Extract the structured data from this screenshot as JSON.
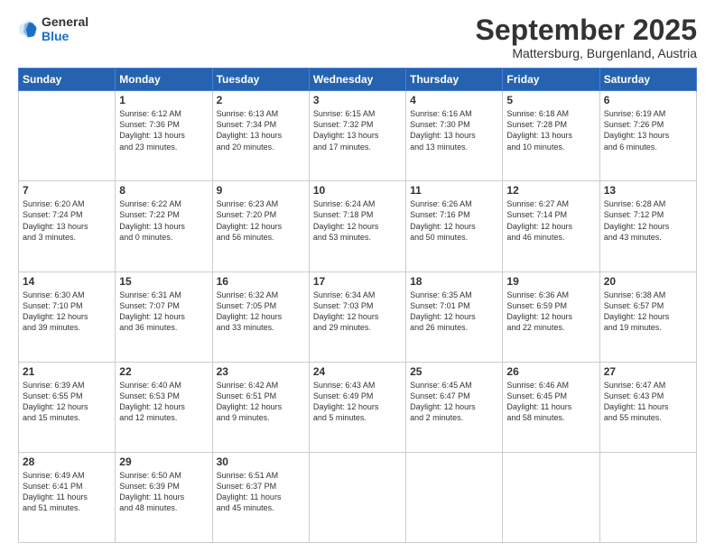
{
  "logo": {
    "general": "General",
    "blue": "Blue"
  },
  "header": {
    "month": "September 2025",
    "location": "Mattersburg, Burgenland, Austria"
  },
  "days": [
    "Sunday",
    "Monday",
    "Tuesday",
    "Wednesday",
    "Thursday",
    "Friday",
    "Saturday"
  ],
  "weeks": [
    [
      {
        "day": "",
        "info": ""
      },
      {
        "day": "1",
        "info": "Sunrise: 6:12 AM\nSunset: 7:36 PM\nDaylight: 13 hours\nand 23 minutes."
      },
      {
        "day": "2",
        "info": "Sunrise: 6:13 AM\nSunset: 7:34 PM\nDaylight: 13 hours\nand 20 minutes."
      },
      {
        "day": "3",
        "info": "Sunrise: 6:15 AM\nSunset: 7:32 PM\nDaylight: 13 hours\nand 17 minutes."
      },
      {
        "day": "4",
        "info": "Sunrise: 6:16 AM\nSunset: 7:30 PM\nDaylight: 13 hours\nand 13 minutes."
      },
      {
        "day": "5",
        "info": "Sunrise: 6:18 AM\nSunset: 7:28 PM\nDaylight: 13 hours\nand 10 minutes."
      },
      {
        "day": "6",
        "info": "Sunrise: 6:19 AM\nSunset: 7:26 PM\nDaylight: 13 hours\nand 6 minutes."
      }
    ],
    [
      {
        "day": "7",
        "info": "Sunrise: 6:20 AM\nSunset: 7:24 PM\nDaylight: 13 hours\nand 3 minutes."
      },
      {
        "day": "8",
        "info": "Sunrise: 6:22 AM\nSunset: 7:22 PM\nDaylight: 13 hours\nand 0 minutes."
      },
      {
        "day": "9",
        "info": "Sunrise: 6:23 AM\nSunset: 7:20 PM\nDaylight: 12 hours\nand 56 minutes."
      },
      {
        "day": "10",
        "info": "Sunrise: 6:24 AM\nSunset: 7:18 PM\nDaylight: 12 hours\nand 53 minutes."
      },
      {
        "day": "11",
        "info": "Sunrise: 6:26 AM\nSunset: 7:16 PM\nDaylight: 12 hours\nand 50 minutes."
      },
      {
        "day": "12",
        "info": "Sunrise: 6:27 AM\nSunset: 7:14 PM\nDaylight: 12 hours\nand 46 minutes."
      },
      {
        "day": "13",
        "info": "Sunrise: 6:28 AM\nSunset: 7:12 PM\nDaylight: 12 hours\nand 43 minutes."
      }
    ],
    [
      {
        "day": "14",
        "info": "Sunrise: 6:30 AM\nSunset: 7:10 PM\nDaylight: 12 hours\nand 39 minutes."
      },
      {
        "day": "15",
        "info": "Sunrise: 6:31 AM\nSunset: 7:07 PM\nDaylight: 12 hours\nand 36 minutes."
      },
      {
        "day": "16",
        "info": "Sunrise: 6:32 AM\nSunset: 7:05 PM\nDaylight: 12 hours\nand 33 minutes."
      },
      {
        "day": "17",
        "info": "Sunrise: 6:34 AM\nSunset: 7:03 PM\nDaylight: 12 hours\nand 29 minutes."
      },
      {
        "day": "18",
        "info": "Sunrise: 6:35 AM\nSunset: 7:01 PM\nDaylight: 12 hours\nand 26 minutes."
      },
      {
        "day": "19",
        "info": "Sunrise: 6:36 AM\nSunset: 6:59 PM\nDaylight: 12 hours\nand 22 minutes."
      },
      {
        "day": "20",
        "info": "Sunrise: 6:38 AM\nSunset: 6:57 PM\nDaylight: 12 hours\nand 19 minutes."
      }
    ],
    [
      {
        "day": "21",
        "info": "Sunrise: 6:39 AM\nSunset: 6:55 PM\nDaylight: 12 hours\nand 15 minutes."
      },
      {
        "day": "22",
        "info": "Sunrise: 6:40 AM\nSunset: 6:53 PM\nDaylight: 12 hours\nand 12 minutes."
      },
      {
        "day": "23",
        "info": "Sunrise: 6:42 AM\nSunset: 6:51 PM\nDaylight: 12 hours\nand 9 minutes."
      },
      {
        "day": "24",
        "info": "Sunrise: 6:43 AM\nSunset: 6:49 PM\nDaylight: 12 hours\nand 5 minutes."
      },
      {
        "day": "25",
        "info": "Sunrise: 6:45 AM\nSunset: 6:47 PM\nDaylight: 12 hours\nand 2 minutes."
      },
      {
        "day": "26",
        "info": "Sunrise: 6:46 AM\nSunset: 6:45 PM\nDaylight: 11 hours\nand 58 minutes."
      },
      {
        "day": "27",
        "info": "Sunrise: 6:47 AM\nSunset: 6:43 PM\nDaylight: 11 hours\nand 55 minutes."
      }
    ],
    [
      {
        "day": "28",
        "info": "Sunrise: 6:49 AM\nSunset: 6:41 PM\nDaylight: 11 hours\nand 51 minutes."
      },
      {
        "day": "29",
        "info": "Sunrise: 6:50 AM\nSunset: 6:39 PM\nDaylight: 11 hours\nand 48 minutes."
      },
      {
        "day": "30",
        "info": "Sunrise: 6:51 AM\nSunset: 6:37 PM\nDaylight: 11 hours\nand 45 minutes."
      },
      {
        "day": "",
        "info": ""
      },
      {
        "day": "",
        "info": ""
      },
      {
        "day": "",
        "info": ""
      },
      {
        "day": "",
        "info": ""
      }
    ]
  ]
}
